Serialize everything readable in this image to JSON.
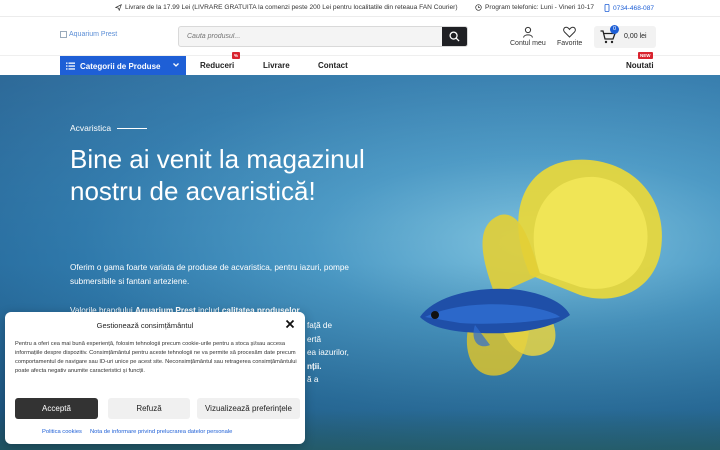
{
  "topbar": {
    "shipping": "Livrare de la 17.99 Lei (LIVRARE GRATUITA la comenzi peste 200 Lei pentru localitatile din reteaua FAN Courier)",
    "hours": "Program telefonic: Luni - Vineri 10-17",
    "phone": "0734-468-087"
  },
  "header": {
    "logo_alt": "Aquarium Prest",
    "search_placeholder": "Cauta produsul...",
    "account_label": "Contul meu",
    "favorites_label": "Favorite",
    "cart_count": "0",
    "cart_total": "0,00 lei"
  },
  "nav": {
    "categories_label": "Categorii de Produse",
    "items": [
      {
        "label": "Reduceri",
        "badge": "%"
      },
      {
        "label": "Livrare"
      },
      {
        "label": "Contact"
      }
    ],
    "new_label": "Noutati",
    "new_badge": "NEW"
  },
  "hero": {
    "eyebrow": "Acvaristica",
    "title": "Bine ai venit la magazinul nostru de acvaristică!",
    "paragraph1": "Oferim o gama foarte variata de produse de acvaristica, pentru iazuri, pompe submersibile si fantani arteziene.",
    "p2_a": "Valorile brandului ",
    "p2_b": "Aquarium Prest",
    "p2_c": " includ ",
    "p2_d": "calitatea produselor",
    "p2_e": ",",
    "p2_partial": [
      "față de",
      "ertă",
      "ea iazurilor,",
      "nții.",
      "ă a"
    ]
  },
  "cookie": {
    "title": "Gestionează consimțământul",
    "text": "Pentru a oferi cea mai bună experiență, folosim tehnologii precum cookie-urile pentru a stoca și/sau accesa informațiile despre dispozitiv. Consimțământul pentru aceste tehnologii ne va permite să procesăm date precum comportamentul de navigare sau ID-uri unice pe acest site. Neconsimțământul sau retragerea consimțământului poate afecta negativ anumite caracteristici și funcții.",
    "accept": "Acceptă",
    "deny": "Refuză",
    "preferences": "Vizualizează preferințele",
    "link1": "Politica cookies",
    "link2": "Nota de informare privind prelucrarea datelor personale"
  },
  "colors": {
    "brand_blue": "#1e5fd6",
    "badge_red": "#d9242f",
    "accept_dark": "#333333"
  }
}
